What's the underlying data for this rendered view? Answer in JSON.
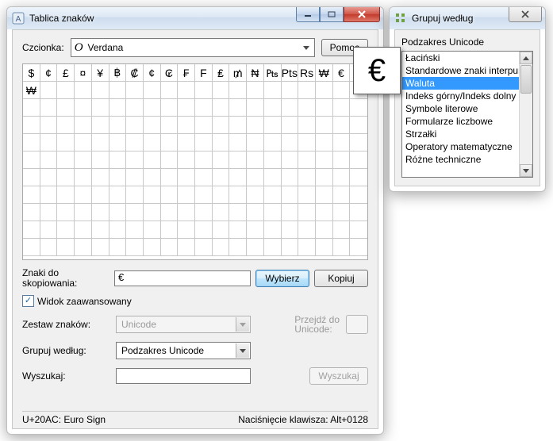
{
  "main": {
    "title": "Tablica znaków",
    "font_label": "Czcionka:",
    "font_value": "Verdana",
    "help_label": "Pomoc",
    "chars": [
      "$",
      "¢",
      "£",
      "¤",
      "¥",
      "฿",
      "₡",
      "¢",
      "₢",
      "₣",
      "F",
      "₤",
      "₥",
      "₦",
      "₧",
      "Pts",
      "Rs",
      "₩",
      "€",
      "₩"
    ],
    "magnifier_char": "€",
    "copy_label_a": "Znaki do",
    "copy_label_b": "skopiowania:",
    "copy_value": "€",
    "select_label": "Wybierz",
    "copy_btn": "Kopiuj",
    "advanced_check": "Widok zaawansowany",
    "charset_label": "Zestaw znaków:",
    "charset_value": "Unicode",
    "goto_label_a": "Przejdź do",
    "goto_label_b": "Unicode:",
    "group_label": "Grupuj według:",
    "group_value": "Podzakres Unicode",
    "search_label": "Wyszukaj:",
    "search_btn": "Wyszukaj",
    "status_left": "U+20AC: Euro Sign",
    "status_right": "Naciśnięcie klawisza: Alt+0128"
  },
  "group": {
    "title": "Grupuj według",
    "header": "Podzakres Unicode",
    "items": [
      "Łaciński",
      "Standardowe znaki interpunkcyjne",
      "Waluta",
      "Indeks górny/Indeks dolny",
      "Symbole literowe",
      "Formularze liczbowe",
      "Strzałki",
      "Operatory matematyczne",
      "Różne techniczne"
    ],
    "selected_index": 2
  }
}
